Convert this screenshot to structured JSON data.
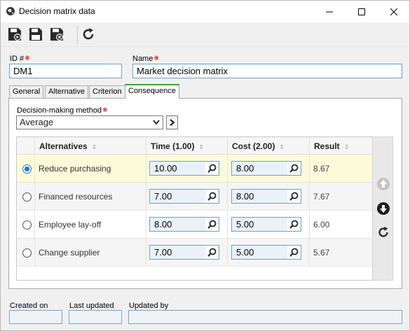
{
  "window": {
    "title": "Decision matrix data",
    "icons": [
      "app-globe-icon",
      "minimize-icon",
      "maximize-icon",
      "close-icon"
    ]
  },
  "toolbar": {
    "buttons": [
      "save-new-icon",
      "save-icon",
      "save-close-icon",
      "refresh-icon"
    ]
  },
  "form": {
    "id_label": "ID #",
    "id_value": "DM1",
    "name_label": "Name",
    "name_value": "Market decision matrix"
  },
  "tabs": [
    {
      "label": "General",
      "active": false
    },
    {
      "label": "Alternative",
      "active": false
    },
    {
      "label": "Criterion",
      "active": false
    },
    {
      "label": "Consequence",
      "active": true
    }
  ],
  "consequence": {
    "method_label": "Decision-making method",
    "method_value": "Average",
    "columns": [
      "Alternatives",
      "Time (1.00)",
      "Cost (2.00)",
      "Result"
    ],
    "rows": [
      {
        "name": "Reduce purchasing",
        "time": "10.00",
        "cost": "8.00",
        "result": "8.67",
        "selected": true
      },
      {
        "name": "Financed resources",
        "time": "7.00",
        "cost": "8.00",
        "result": "7.67",
        "selected": false
      },
      {
        "name": "Employee lay-off",
        "time": "8.00",
        "cost": "5.00",
        "result": "6.00",
        "selected": false
      },
      {
        "name": "Change supplier",
        "time": "7.00",
        "cost": "5.00",
        "result": "5.67",
        "selected": false
      }
    ],
    "side_buttons": [
      "move-up-icon",
      "move-down-icon",
      "refresh-icon"
    ]
  },
  "footer": {
    "created_on_label": "Created on",
    "created_on_value": "",
    "last_updated_label": "Last updated",
    "last_updated_value": "",
    "updated_by_label": "Updated by",
    "updated_by_value": ""
  },
  "colors": {
    "selected_row": "#fbfbda",
    "active_tab_accent": "#3aa140",
    "required_marker": "#d11111",
    "radio_selected": "#1a73d9"
  }
}
